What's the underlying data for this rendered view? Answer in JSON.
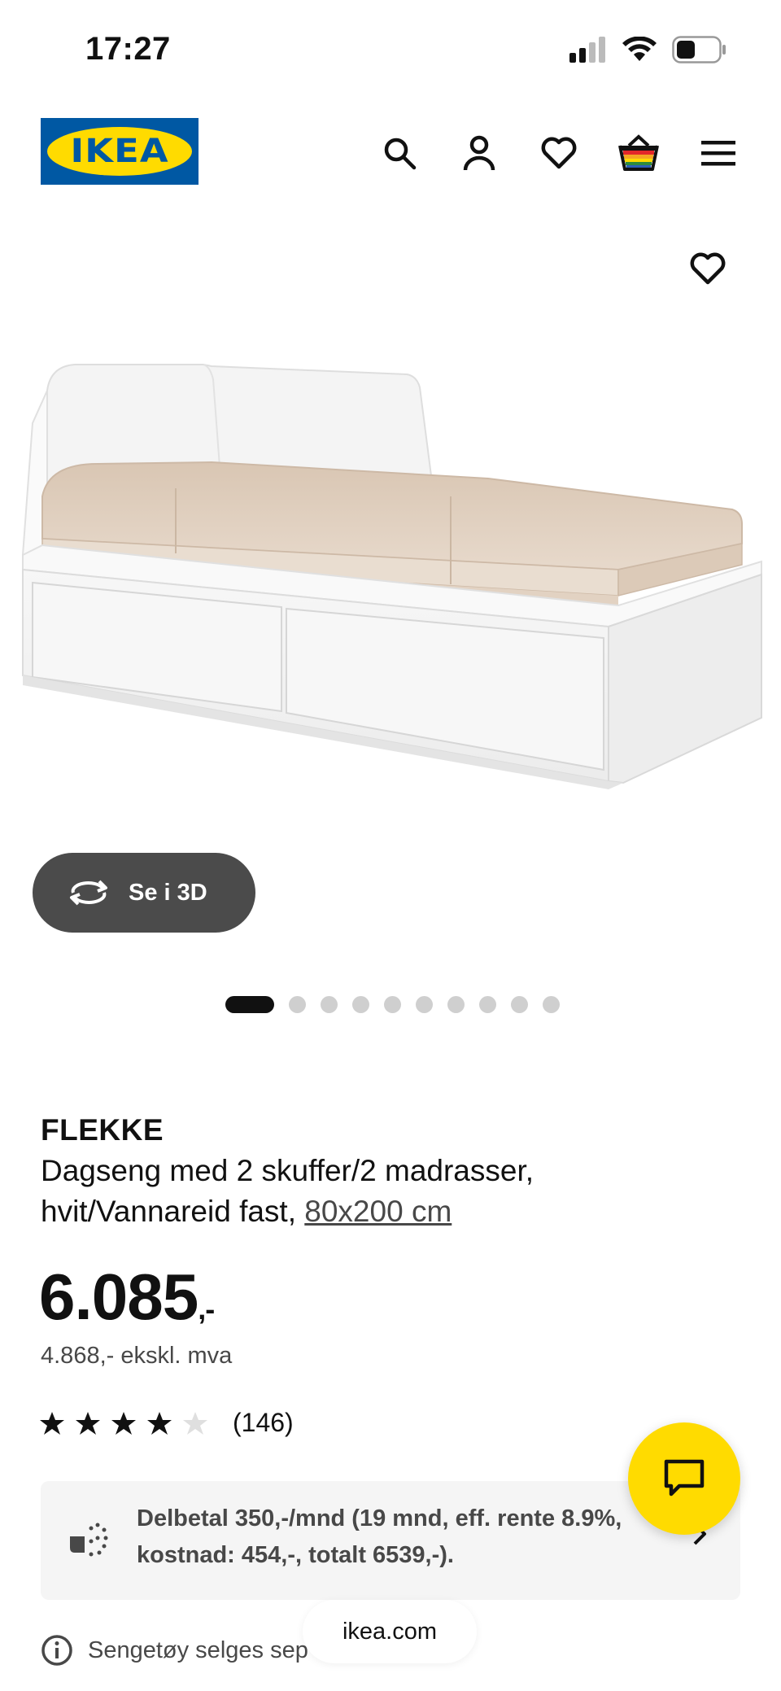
{
  "status_bar": {
    "time": "17:27"
  },
  "header": {
    "logo_text": "IKEA",
    "icons": [
      "search-icon",
      "account-icon",
      "favourites-icon",
      "cart-icon",
      "menu-icon"
    ]
  },
  "hero": {
    "view_3d_label": "Se i 3D",
    "carousel": {
      "total": 10,
      "active_index": 0
    }
  },
  "product": {
    "name": "FLEKKE",
    "description": "Dagseng med 2 skuffer/2 madrasser, hvit/Vannareid fast,",
    "size_link": "80x200 cm",
    "price": "6.085",
    "price_suffix": ",-",
    "price_ex_vat": "4.868,- ekskl. mva",
    "rating": {
      "stars": 4,
      "max": 5,
      "count_label": "(146)"
    }
  },
  "finance": {
    "text": "Delbetal 350,-/mnd (19 mnd, eff. rente 8.9%, kostnad: 454,-, totalt 6539,-)."
  },
  "note": {
    "text": "Sengetøy selges sep"
  },
  "browser": {
    "url": "ikea.com"
  },
  "colors": {
    "ikea_blue": "#0058a3",
    "ikea_yellow": "#ffdb00",
    "button_dark": "#4b4b4b"
  }
}
